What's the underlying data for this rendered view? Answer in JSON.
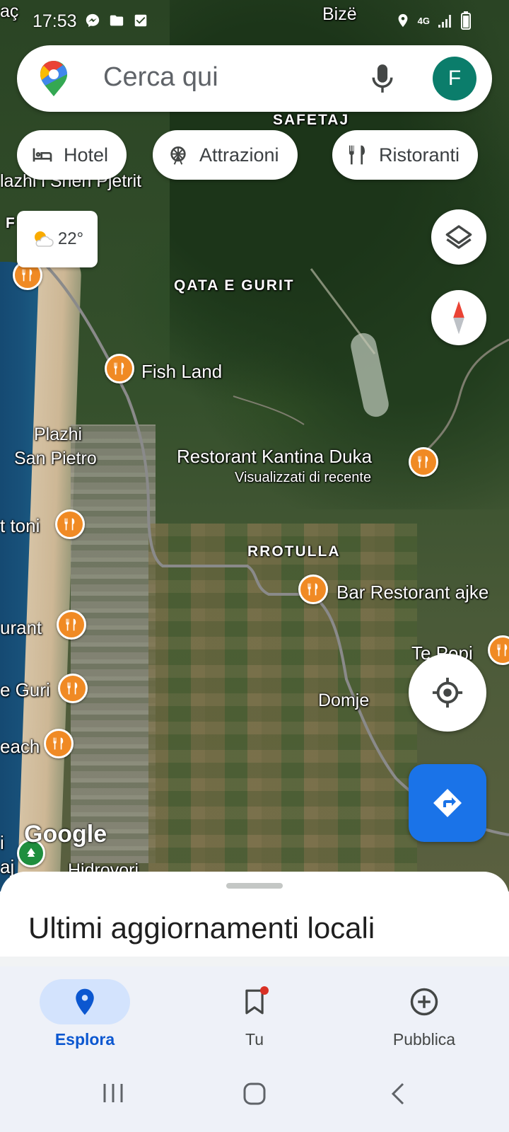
{
  "status_bar": {
    "time": "17:53",
    "network": "4G",
    "icons_left": [
      "messenger-icon",
      "folder-icon",
      "checkbox-icon"
    ],
    "icons_right": [
      "location-icon",
      "4g-icon",
      "signal-icon",
      "battery-icon"
    ]
  },
  "search": {
    "placeholder": "Cerca qui",
    "avatar_letter": "F",
    "avatar_color": "#0b7d6b"
  },
  "chips": [
    {
      "label": "Hotel",
      "icon": "bed-icon"
    },
    {
      "label": "Attrazioni",
      "icon": "ferris-wheel-icon"
    },
    {
      "label": "Ristoranti",
      "icon": "fork-knife-icon"
    }
  ],
  "weather": {
    "temperature": "22°",
    "icon": "partly-cloudy-icon"
  },
  "map": {
    "place_labels": {
      "bize": "Bizë",
      "safetaj": "SAFETAJ",
      "qata_e_gurit": "QATA E GURIT",
      "plazhi_shen_pjetri": "lazhi i Shen Pjetrit",
      "aci": "F        AÇI",
      "plazhi": "Plazhi",
      "san_pietro": "San Pietro",
      "rrotulla": "RROTULLA",
      "domje": "Domje",
      "top_left": "aç",
      "hidrovori": "Hidrovori"
    },
    "pois": {
      "fish_land": "Fish Land",
      "kantina_duka": "Restorant Kantina Duka",
      "kantina_duka_sub": "Visualizzati di recente",
      "toni": "t toni",
      "bar_restorant": "Bar Restorant ajke",
      "te_popi": "Te Popi",
      "urant": "urant",
      "e_guri": "e Guri",
      "each": "each",
      "i_label": "i",
      "aj_label": "aj"
    },
    "watermark": "Google",
    "poi_color": "#f08a24"
  },
  "sheet": {
    "title": "Ultimi aggiornamenti locali"
  },
  "bottom_nav": [
    {
      "label": "Esplora",
      "icon": "location-pin-icon",
      "active": true
    },
    {
      "label": "Tu",
      "icon": "bookmark-icon",
      "active": false,
      "has_dot": true
    },
    {
      "label": "Pubblica",
      "icon": "add-circle-icon",
      "active": false
    }
  ],
  "colors": {
    "accent": "#1a73e8",
    "active_nav": "#0b57d0",
    "notification_dot": "#d93025"
  }
}
